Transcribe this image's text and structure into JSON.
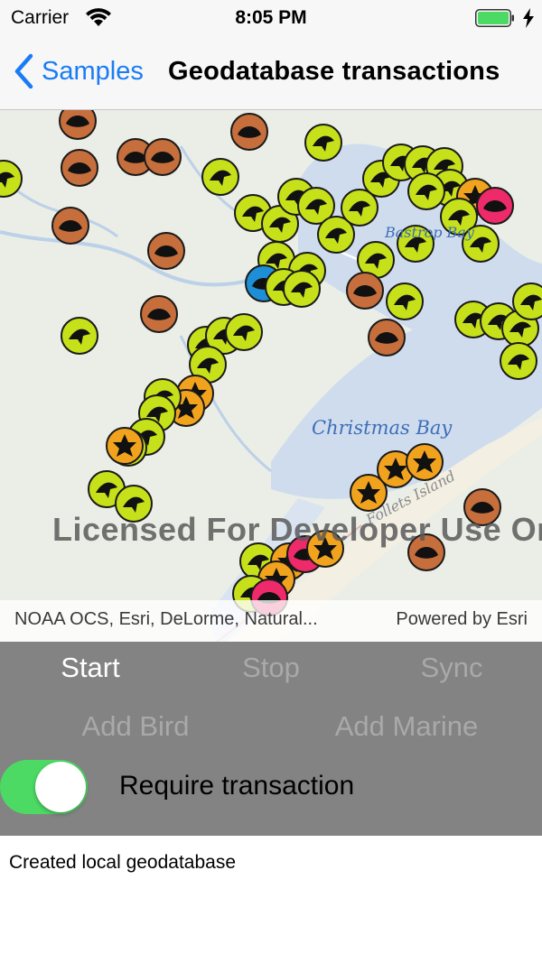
{
  "status_bar": {
    "carrier": "Carrier",
    "time": "8:05 PM",
    "battery_color": "#4cd964"
  },
  "nav": {
    "back_label": "Samples",
    "title": "Geodatabase transactions",
    "accent": "#1a7cf5"
  },
  "map": {
    "place_labels": {
      "christmas_bay": "Christmas Bay",
      "bastrop_bay": "Bastrop Bay",
      "island": "Follets Island"
    },
    "watermark": "Licensed For Developer Use Only",
    "attribution": "NOAA OCS, Esri, DeLorme, Natural...",
    "powered_by": "Powered by Esri",
    "symbol_colors": {
      "bird": "#c6e11a",
      "marine": "#c66e3c",
      "sea_turtle": "#ee2a6a",
      "star": "#f2a31e",
      "fish": "#1e8fd6"
    }
  },
  "toolbar": {
    "start": "Start",
    "stop": "Stop",
    "sync": "Sync",
    "add_bird": "Add Bird",
    "add_marine": "Add Marine",
    "require_transaction": "Require transaction",
    "require_transaction_on": true
  },
  "log": {
    "message": "Created local geodatabase"
  }
}
